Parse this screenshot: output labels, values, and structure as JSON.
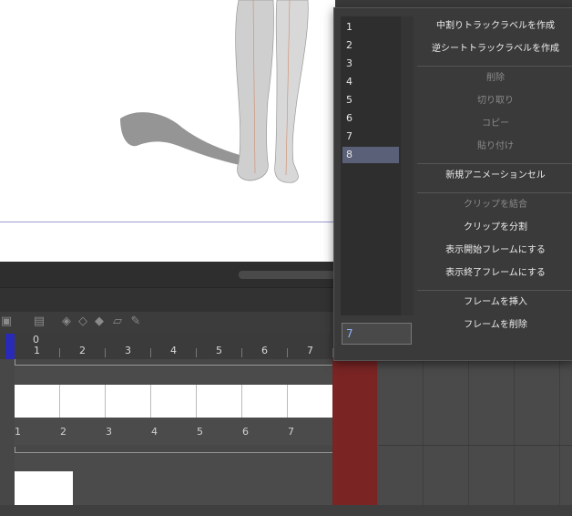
{
  "popup": {
    "list_items": [
      "1",
      "2",
      "3",
      "4",
      "5",
      "6",
      "7",
      "8"
    ],
    "selected_index": 7,
    "input_value": "7",
    "menu": [
      {
        "label": "中割りトラックラベルを作成",
        "enabled": true
      },
      {
        "label": "逆シートトラックラベルを作成",
        "enabled": true
      },
      {
        "sep": true
      },
      {
        "label": "削除",
        "enabled": false
      },
      {
        "label": "切り取り",
        "enabled": false
      },
      {
        "label": "コピー",
        "enabled": false
      },
      {
        "label": "貼り付け",
        "enabled": false
      },
      {
        "sep": true
      },
      {
        "label": "新規アニメーションセル",
        "enabled": true
      },
      {
        "sep": true
      },
      {
        "label": "クリップを結合",
        "enabled": false
      },
      {
        "label": "クリップを分割",
        "enabled": true
      },
      {
        "label": "表示開始フレームにする",
        "enabled": true
      },
      {
        "label": "表示終了フレームにする",
        "enabled": true
      },
      {
        "sep": true
      },
      {
        "label": "フレームを挿入",
        "enabled": true
      },
      {
        "label": "フレームを削除",
        "enabled": true
      }
    ]
  },
  "timeline": {
    "ruler_zero": "0",
    "ruler_numbers": [
      "1",
      "2",
      "3",
      "4",
      "5",
      "6",
      "7"
    ],
    "track_frame_numbers": [
      "1",
      "2",
      "3",
      "4",
      "5",
      "6",
      "7"
    ]
  },
  "colors": {
    "accent_selected": "#5a6078",
    "playhead": "#2a2ab8",
    "out_of_range": "#7a2424"
  }
}
